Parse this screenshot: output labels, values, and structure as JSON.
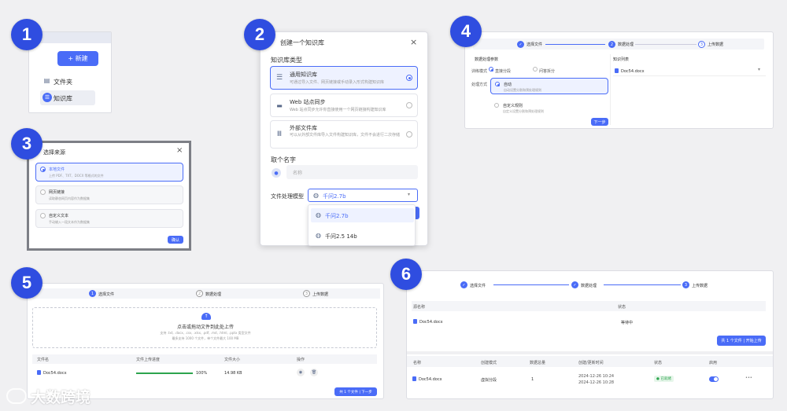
{
  "badges": [
    "1",
    "2",
    "3",
    "4",
    "5",
    "6"
  ],
  "p1": {
    "new_button": "+ 新建",
    "menu": [
      "文件夹",
      "知识库"
    ]
  },
  "p2": {
    "title": "创建一个知识库",
    "type_label": "知识库类型",
    "types": [
      {
        "title": "通用知识库",
        "desc": "可通过导入文件、网页链接或手动录入形式构建知识库"
      },
      {
        "title": "Web 站点同步",
        "desc": "Web 站点同步允许你直接使用一个网页链接构建知识库"
      },
      {
        "title": "外部文件库",
        "desc": "可以从外部文件库导入文件构建知识库，文件不会进行二次存储"
      }
    ],
    "name_label": "取个名字",
    "name_placeholder": "名称",
    "model_label": "文件处理模型",
    "model_value": "千问2.7b",
    "options": [
      "千问2.7b",
      "千问2.5 14b"
    ]
  },
  "p3": {
    "title": "选择来源",
    "sources": [
      {
        "title": "本地文件",
        "desc": "上传 PDF、TXT、DOCX 等格式的文件"
      },
      {
        "title": "网页链接",
        "desc": "读取静态网页内容作为数据集"
      },
      {
        "title": "自定义文本",
        "desc": "手动输入一段文本作为数据集"
      }
    ],
    "confirm": "确认"
  },
  "p4": {
    "steps": [
      "选择文件",
      "数据处理",
      "上传数据"
    ],
    "left_title": "数据处理参数",
    "mode_label": "训练模式",
    "mode_opts": [
      "直接分段",
      "问答拆分"
    ],
    "method_label": "处理方式",
    "methods": [
      {
        "title": "自动",
        "desc": "自动设置分割和预处理规则"
      },
      {
        "title": "自定义规则",
        "desc": "自定义设置分割和预处理规则"
      }
    ],
    "next": "下一步",
    "right_title": "知识列表",
    "file": "Doc54.docx"
  },
  "p5": {
    "steps": [
      "选择文件",
      "数据处理",
      "上传数据"
    ],
    "drop_title": "点击或拖动文件到此处上传",
    "drop_desc1": "支持 .txt, .docx, .csv, .xlsx, .pdf, .md, .html, .pptx 类型文件",
    "drop_desc2": "最多支持 1000 个文件，单个文件最大 100 MB",
    "cols": [
      "文件名",
      "文件上传进度",
      "文件大小",
      "操作"
    ],
    "row": {
      "name": "Doc54.docx",
      "progress": "100%",
      "progress_value": 1.0,
      "size": "14.98 KB"
    },
    "next": "共 1 个文件 | 下一步"
  },
  "p6": {
    "steps": [
      "选择文件",
      "数据处理",
      "上传数据"
    ],
    "top_cols": [
      "源名称",
      "状态"
    ],
    "top_row": {
      "name": "Doc54.docx",
      "status": "等待中"
    },
    "upload_btn": "共 1 个文件 | 开始上传",
    "cols": [
      "名称",
      "创建模式",
      "数据总量",
      "创建/更新时间",
      "状态",
      "启用"
    ],
    "row": {
      "name": "Doc54.docx",
      "mode": "虚拟分段",
      "count": "1",
      "created": "2024-12-26 10:24",
      "updated": "2024-12-26 10:28",
      "status": "● 已就绪",
      "more": "•••"
    }
  },
  "watermark": "大数跨境",
  "colors": {
    "accent": "#4a6cf7",
    "badge": "#2f4de0",
    "ready": "#2da44e"
  }
}
